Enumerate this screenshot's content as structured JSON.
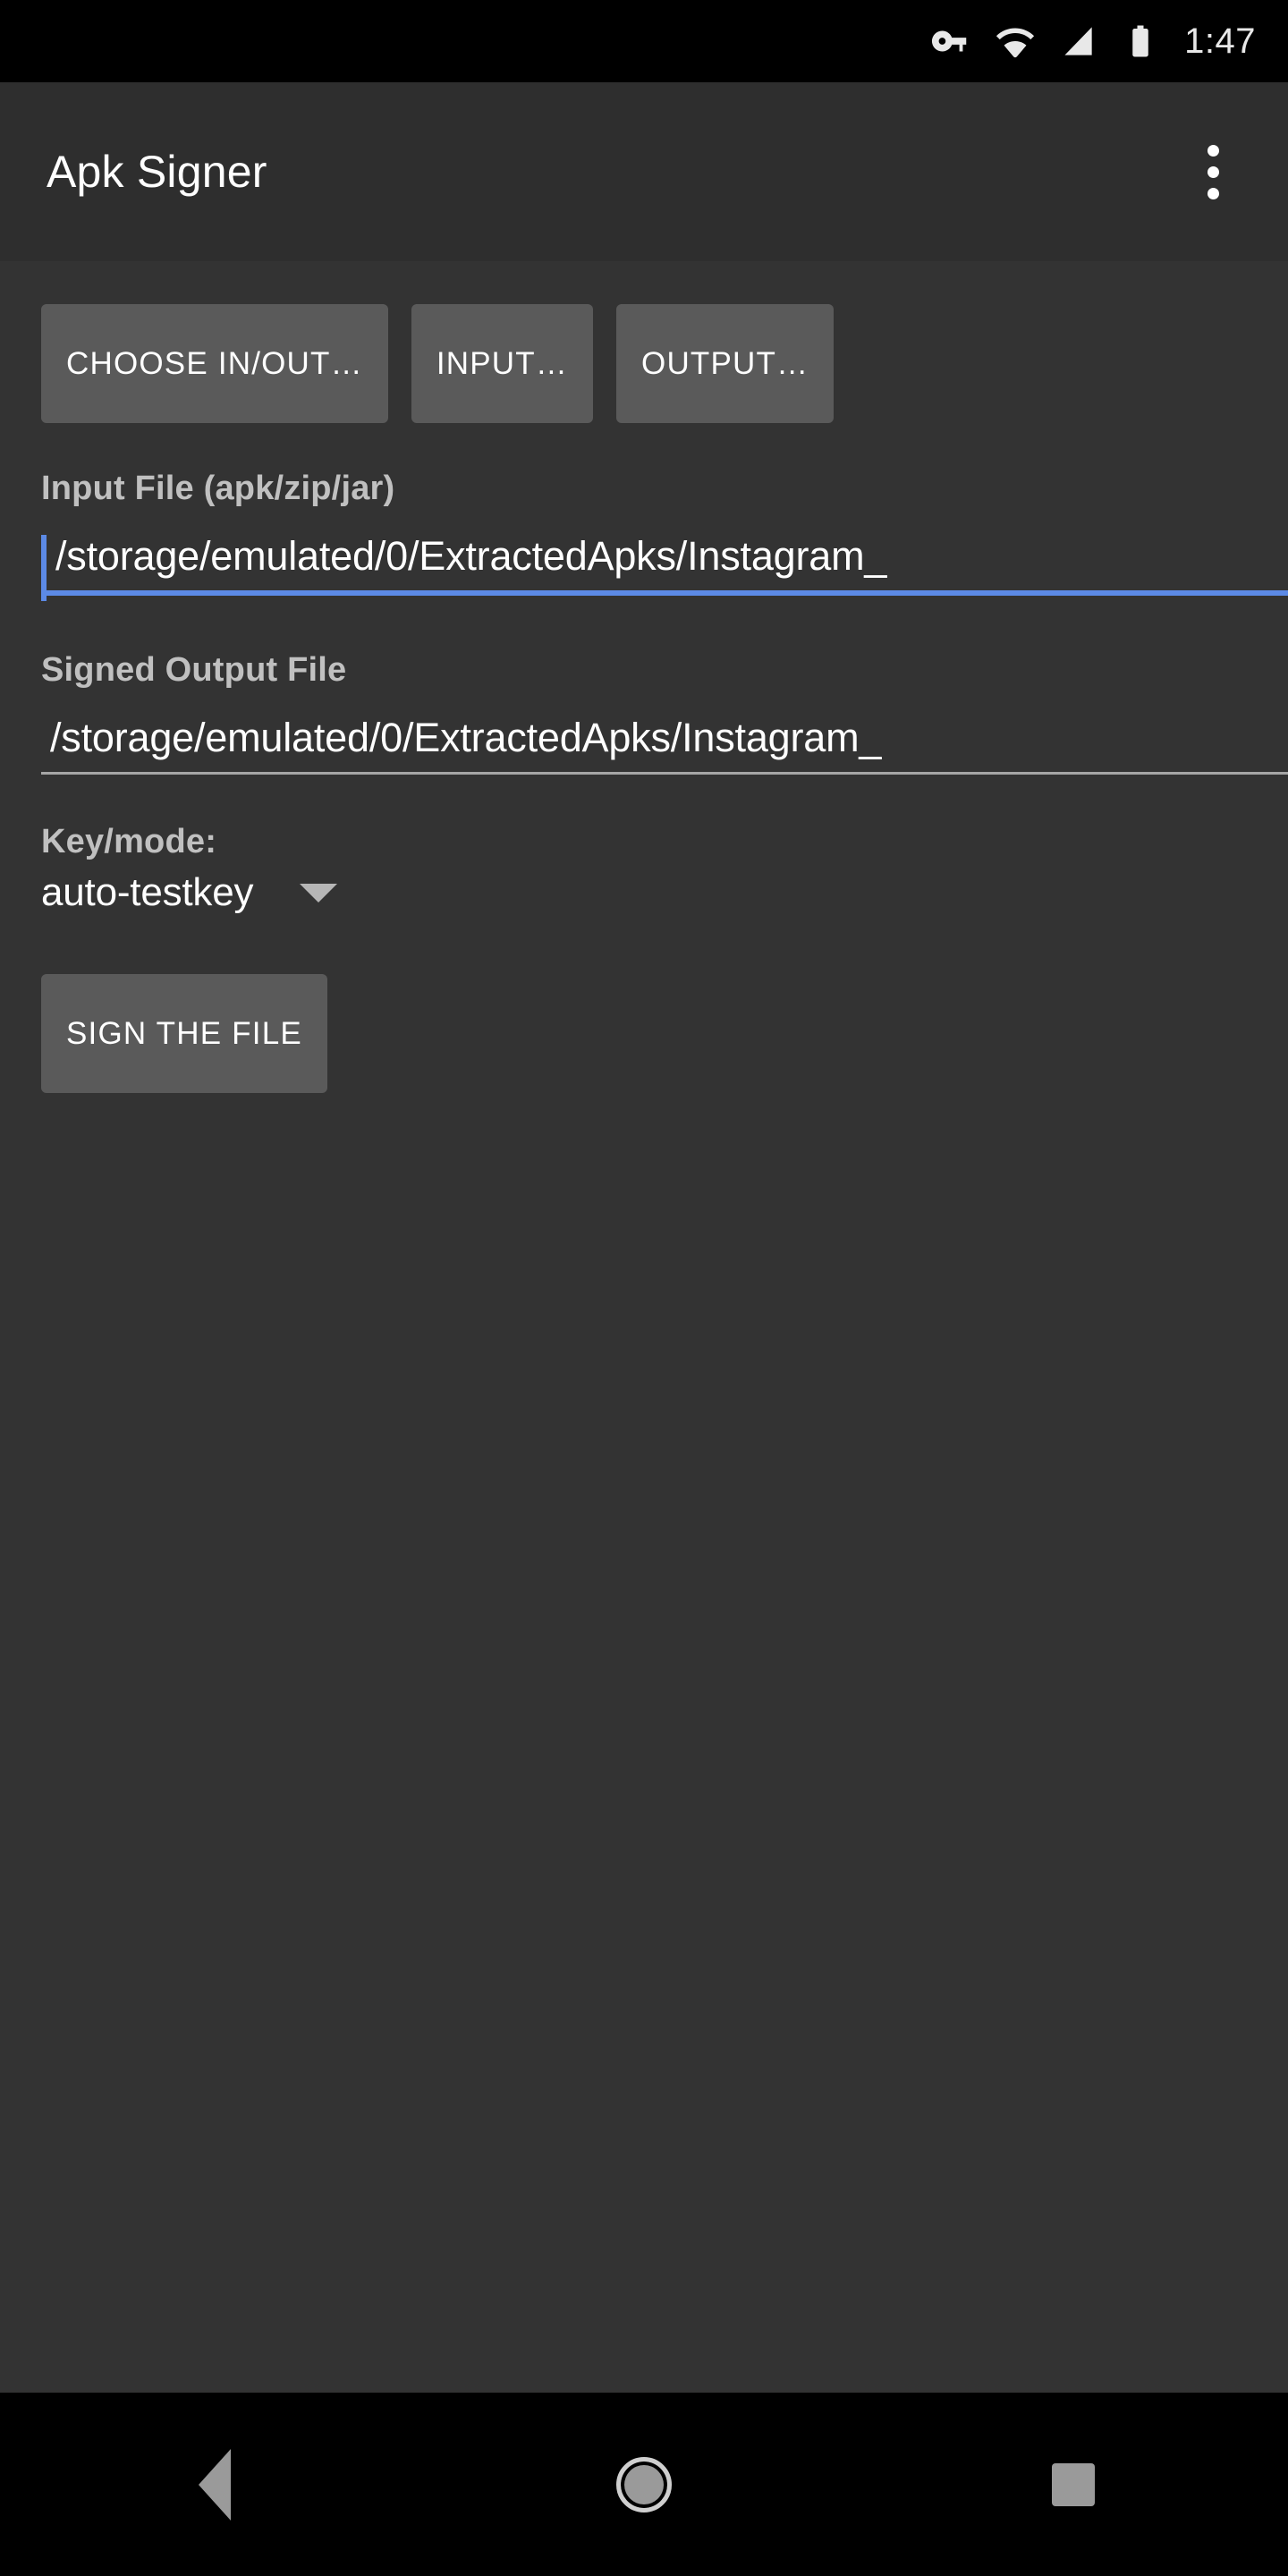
{
  "status_bar": {
    "icons": [
      "vpn-key-icon",
      "wifi-icon",
      "cellular-signal-icon",
      "battery-icon"
    ],
    "time": "1:47"
  },
  "app_bar": {
    "title": "Apk Signer",
    "overflow_icon": "more-vert-icon"
  },
  "toolbar_buttons": {
    "choose_in_out": "CHOOSE IN/OUT…",
    "input": "INPUT…",
    "output": "OUTPUT…"
  },
  "input_file": {
    "label": "Input File (apk/zip/jar)",
    "value": "/storage/emulated/0/ExtractedApks/Instagram_",
    "focused": true
  },
  "output_file": {
    "label": "Signed Output File",
    "value": "/storage/emulated/0/ExtractedApks/Instagram_",
    "focused": false
  },
  "key_mode": {
    "label": "Key/mode:",
    "selected": "auto-testkey",
    "arrow_icon": "chevron-down-icon"
  },
  "sign_action": {
    "label": "SIGN THE FILE"
  },
  "nav_bar": {
    "back_icon": "back-triangle-icon",
    "home_icon": "home-circle-icon",
    "recents_icon": "recents-square-icon"
  },
  "colors": {
    "accent_blue": "#5c8ae6",
    "app_bar_bg": "#2e2e2e",
    "content_bg": "#333333",
    "button_bg": "#5a5a5a",
    "label_gray": "#c0c0c0",
    "underline_gray": "#a6a6a6",
    "nav_icon_gray": "#9a9a9a"
  }
}
